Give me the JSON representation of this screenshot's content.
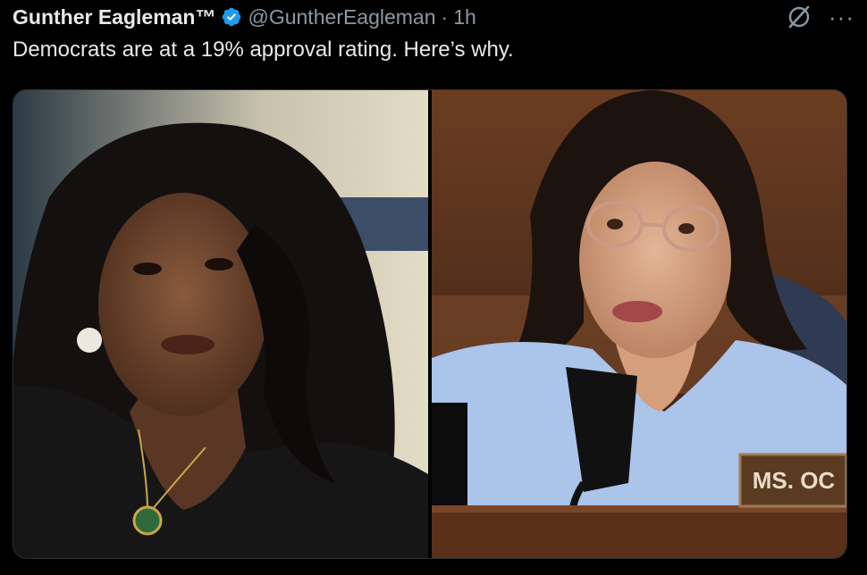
{
  "tweet": {
    "author_name": "Gunther Eagleman™",
    "author_handle": "@GuntherEagleman",
    "separator": "·",
    "timestamp": "1h",
    "text": "Democrats are at a 19% approval rating.  Here’s why.",
    "verified": true
  },
  "icons": {
    "verified": "verified-badge-icon",
    "grok": "grok-icon",
    "more": "more-options-icon"
  },
  "media": {
    "left_photo_label": "",
    "right_photo_nameplate": "MS. OC"
  },
  "colors": {
    "background": "#000000",
    "text_primary": "#e7e9ea",
    "text_secondary": "#8b98a5",
    "verified_blue": "#1d9bf0"
  }
}
